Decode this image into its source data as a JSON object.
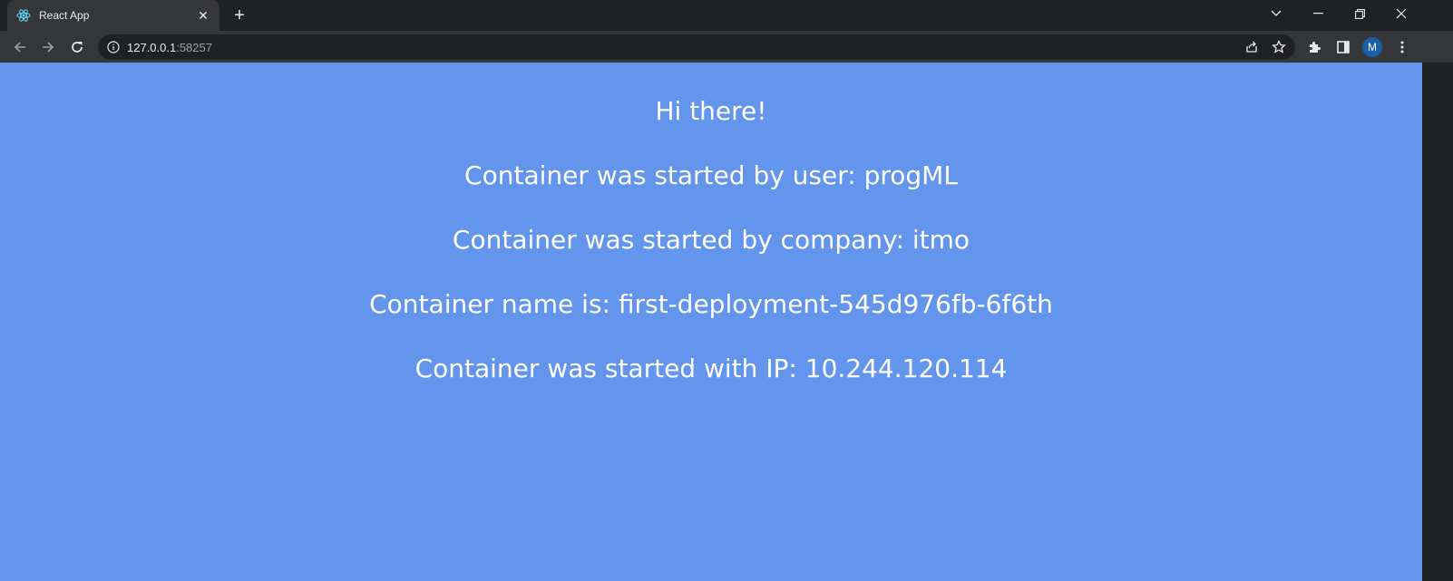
{
  "browser": {
    "tab": {
      "title": "React App",
      "favicon": "react-logo-icon"
    },
    "address": {
      "host": "127.0.0.1",
      "port": ":58257"
    },
    "avatar_letter": "M"
  },
  "page": {
    "background": "#6495ed",
    "lines": [
      "Hi there!",
      "Container was started by user: progML",
      "Container was started by company: itmo",
      "Container name is: first-deployment-545d976fb-6f6th",
      "Container was started with IP: 10.244.120.114"
    ]
  }
}
